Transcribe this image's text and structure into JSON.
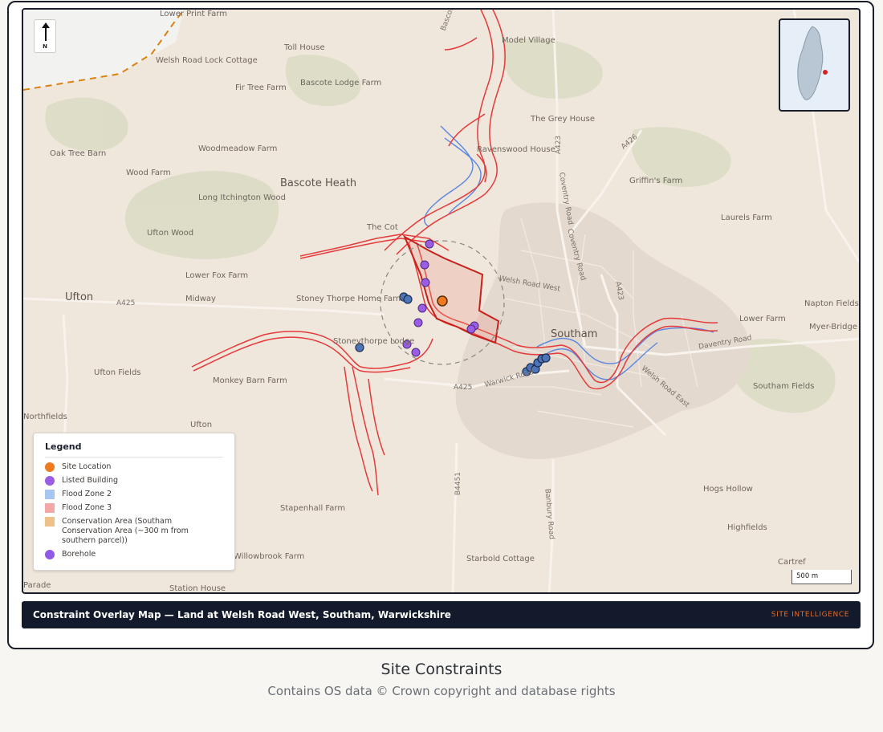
{
  "map": {
    "title": "Constraint Overlay Map — Land at Welsh Road West, Southam, Warwickshire",
    "brand": "SITE INTELLIGENCE",
    "north_label": "N",
    "scale_label": "500 m",
    "legend": {
      "title": "Legend",
      "items": [
        {
          "label": "Site Location",
          "color": "#f07a1f",
          "shape": "circle"
        },
        {
          "label": "Listed Building",
          "color": "#9b5de5",
          "shape": "circle"
        },
        {
          "label": "Flood Zone 2",
          "color": "#a7c7f2",
          "shape": "square"
        },
        {
          "label": "Flood Zone 3",
          "color": "#f3a7a7",
          "shape": "square"
        },
        {
          "label": "Conservation Area (Southam Conservation Area (~300 m from southern parcel))",
          "color": "#f0c08a",
          "shape": "square"
        },
        {
          "label": "Borehole",
          "color": "#8f5ae8",
          "shape": "circle"
        }
      ]
    },
    "place_labels": [
      "Lower Print Farm",
      "Welsh Road Lock Cottage",
      "Toll House",
      "Model Village",
      "Fir Tree Farm",
      "Bascote Lodge Farm",
      "The Grey House",
      "Oak Tree Barn",
      "Woodmeadow Farm",
      "Ravenswood House",
      "Wood Farm",
      "Griffin's Farm",
      "Bascote Heath",
      "Long Itchington Wood",
      "Southam",
      "Laurels Farm",
      "Ufton Wood",
      "Lower Fox Farm",
      "Ufton",
      "Midway",
      "Stoney Thorpe Home Farm",
      "Napton Fields Farm",
      "Lower Farm",
      "Myer-Bridge Farm",
      "Stoneythorpe Lodge",
      "Ufton Fields",
      "Monkey Barn Farm",
      "Southam Fields",
      "Northfields",
      "Ufton",
      "Stapenhall Farm",
      "Hogs Hollow",
      "Highfields",
      "Willowbrook Farm",
      "Starbold Cottage",
      "Cartref",
      "Station House",
      "Parade",
      "The Cot",
      "Bascote"
    ],
    "road_labels": [
      "A425",
      "A425",
      "A423",
      "A426",
      "Coventry Road",
      "Coventry Road",
      "Welsh Road West",
      "A423",
      "Daventry Road",
      "Warwick Road",
      "Welsh Road East",
      "Banbury Road",
      "B4451"
    ]
  },
  "footer": {
    "title": "Site Constraints",
    "subtitle": "Contains OS data © Crown copyright and database rights"
  }
}
